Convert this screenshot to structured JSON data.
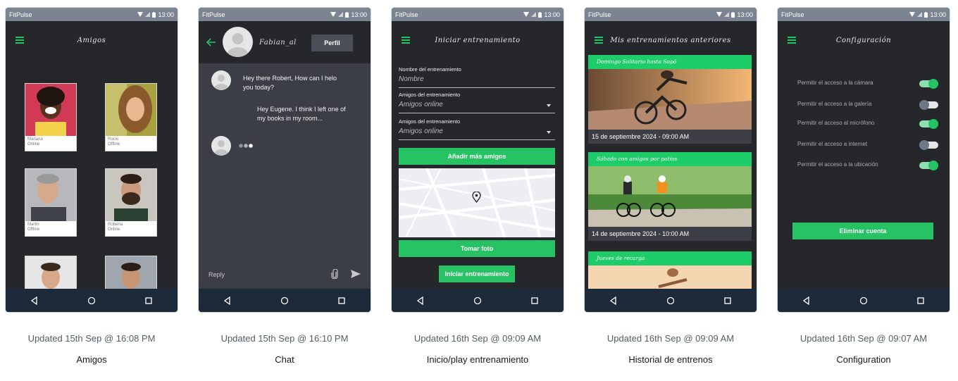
{
  "colors": {
    "accent": "#27c264",
    "phone_bg": "#25272b",
    "status_bar": "#7c8391",
    "nav_bar": "#1d2a3a",
    "chat_body": "#3b3e44"
  },
  "status_bar": {
    "app_name": "FitPulse",
    "time": "13:00"
  },
  "nav_icons": [
    "back-icon",
    "home-icon",
    "recents-icon"
  ],
  "screens": [
    {
      "title": "Amigos",
      "updated": "Updated 15th Sep @ 16:08 PM",
      "caption": "Amigos",
      "friends": [
        {
          "name": "Mariana",
          "status": "Online"
        },
        {
          "name": "Rocio",
          "status": "Offline"
        },
        {
          "name": "Martin",
          "status": "Offline"
        },
        {
          "name": "Roberta",
          "status": "Online"
        },
        {
          "name": "",
          "status": ""
        },
        {
          "name": "",
          "status": ""
        }
      ]
    },
    {
      "title": "Chat",
      "updated": "Updated 15th Sep @ 16:10 PM",
      "caption": "Chat",
      "contact_name": "Fabian_al",
      "profile_button": "Perfil",
      "messages": [
        {
          "from": "other",
          "text": "Hey there Robert, How can I helo you today?"
        },
        {
          "from": "me",
          "text": "Hey Eugene. I think I left one of my books in my room..."
        }
      ],
      "reply_placeholder": "Reply"
    },
    {
      "title": "Iniciar entrenamiento",
      "updated": "Updated 16th Sep @ 09:09 AM",
      "caption": "Inicio/play entrenamiento",
      "fields": [
        {
          "label": "Nombre del entrenamiento",
          "placeholder": "Nombre"
        },
        {
          "label": "Amigos del entrenamiento",
          "placeholder": "Amigos online"
        },
        {
          "label": "Amigos del entrenamiento",
          "placeholder": "Amigos online"
        }
      ],
      "add_friends_button": "Añadir más amigos",
      "take_photo_button": "Tomar foto",
      "start_button": "Iniciar entrenamiento"
    },
    {
      "title": "Mis entrenamientos anteriores",
      "updated": "Updated 16th Sep @ 09:09 AM",
      "caption": "Historial de entrenos",
      "entries": [
        {
          "name": "Domingo Solitario hasta Sopó",
          "date": "15 de septiembre 2024 - 09:00 AM"
        },
        {
          "name": "Sábado con amigos por patios",
          "date": "14 de septiembre 2024 - 10:00 AM"
        },
        {
          "name": "Jueves de recarga",
          "date": ""
        }
      ]
    },
    {
      "title": "Configuración",
      "updated": "Updated 16th Sep @ 09:07 AM",
      "caption": "Configuration",
      "permissions": [
        {
          "label": "Permitir el acceso a la cámara",
          "enabled": true
        },
        {
          "label": "Permitir el acceso a la galería",
          "enabled": false
        },
        {
          "label": "Permitir el acceso al micrófono",
          "enabled": true
        },
        {
          "label": "Permitir el acceso a internet",
          "enabled": false
        },
        {
          "label": "Permitir el acceso a la ubicación",
          "enabled": true
        }
      ],
      "delete_button": "Eliminar cuenta"
    }
  ]
}
